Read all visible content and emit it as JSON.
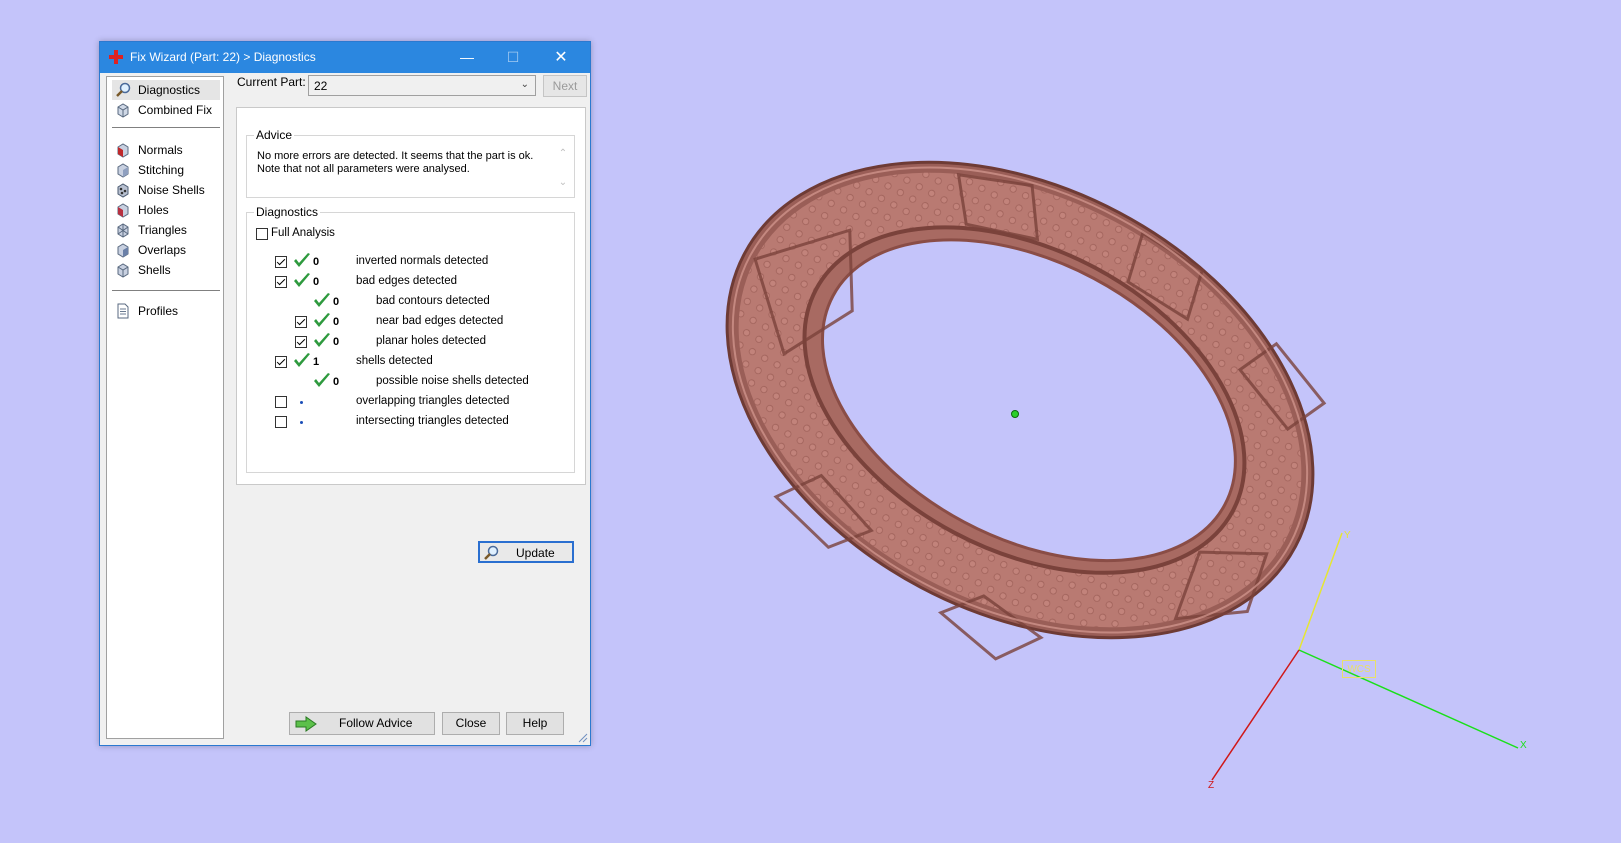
{
  "window": {
    "title": "Fix Wizard (Part: 22) > Diagnostics",
    "close_glyph": "✕",
    "minimize_glyph": "—",
    "maximize_glyph": "☐",
    "accent_color": "#2b87e0"
  },
  "nav": {
    "items": [
      {
        "label": "Diagnostics",
        "icon": "magnifier-icon",
        "selected": true
      },
      {
        "label": "Combined Fix",
        "icon": "cubes-icon"
      },
      {
        "label": "Normals",
        "icon": "normals-cube-icon"
      },
      {
        "label": "Stitching",
        "icon": "stitching-cube-icon"
      },
      {
        "label": "Noise Shells",
        "icon": "noise-shells-icon"
      },
      {
        "label": "Holes",
        "icon": "holes-cube-icon"
      },
      {
        "label": "Triangles",
        "icon": "triangles-cube-icon"
      },
      {
        "label": "Overlaps",
        "icon": "overlaps-cube-icon"
      },
      {
        "label": "Shells",
        "icon": "shells-cube-icon"
      },
      {
        "label": "Profiles",
        "icon": "document-icon"
      }
    ]
  },
  "current_part": {
    "label": "Current Part:",
    "value": "22",
    "next_label": "Next"
  },
  "advice": {
    "caption": "Advice",
    "text_line1": "No more errors are detected. It seems that the part is ok.",
    "text_line2": "Note that not all parameters were analysed."
  },
  "diagnostics": {
    "caption": "Diagnostics",
    "full_analysis_label": "Full Analysis",
    "full_analysis_checked": false,
    "rows": [
      {
        "checked": true,
        "count": "0",
        "label": "inverted normals detected"
      },
      {
        "checked": true,
        "count": "0",
        "label": "bad edges detected"
      },
      {
        "checked": null,
        "count": "0",
        "label": "bad contours detected"
      },
      {
        "checked": true,
        "count": "0",
        "label": "near bad edges detected"
      },
      {
        "checked": true,
        "count": "0",
        "label": "planar holes detected"
      },
      {
        "checked": true,
        "count": "1",
        "label": "shells detected"
      },
      {
        "checked": null,
        "count": "0",
        "label": "possible noise shells detected"
      },
      {
        "checked": false,
        "count": "",
        "label": "overlapping triangles detected"
      },
      {
        "checked": false,
        "count": "",
        "label": "intersecting triangles detected"
      }
    ],
    "update_label": "Update",
    "tick_color": "#2e9a3e"
  },
  "footer": {
    "follow_advice_label": "Follow Advice",
    "close_label": "Close",
    "help_label": "Help"
  },
  "viewport": {
    "background": "#c4c4fa",
    "model_color": "#b97a72",
    "axes": {
      "x": "X",
      "y": "Y",
      "z": "Z",
      "origin_label": "WCS"
    },
    "axis_colors": {
      "x": "#19e019",
      "y": "#e6e632",
      "z": "#d01818"
    }
  }
}
